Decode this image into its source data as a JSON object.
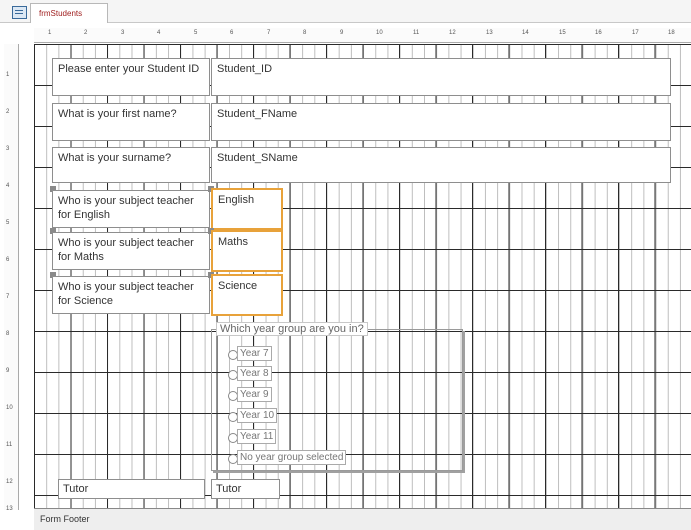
{
  "window": {
    "tab_label": "frmStudents",
    "footer_label": "Form Footer"
  },
  "rulers": {
    "horizontal_marks": [
      "1",
      "2",
      "3",
      "4",
      "5",
      "6",
      "7",
      "8",
      "9",
      "10",
      "11",
      "12",
      "13",
      "14",
      "15",
      "16",
      "17",
      "18"
    ],
    "vertical_marks": [
      "1",
      "2",
      "3",
      "4",
      "5",
      "6",
      "7",
      "8",
      "9",
      "10",
      "11",
      "12",
      "13"
    ]
  },
  "form": {
    "labels": {
      "student_id": "Please enter your Student ID",
      "first_name": "What is your first name?",
      "surname": "What is your surname?",
      "teacher_english": "Who is your subject teacher for English",
      "teacher_maths": "Who is your subject teacher for Maths",
      "teacher_science": "Who is your subject teacher for Science",
      "tutor": "Tutor"
    },
    "fields": {
      "student_id": "Student_ID",
      "first_name": "Student_FName",
      "surname": "Student_SName",
      "english": "English",
      "maths": "Maths",
      "science": "Science",
      "tutor": "Tutor"
    },
    "year_group": {
      "label": "Which year group are you in?",
      "options": [
        "Year 7",
        "Year 8",
        "Year 9",
        "Year 10",
        "Year 11",
        "No year group selected"
      ]
    }
  }
}
